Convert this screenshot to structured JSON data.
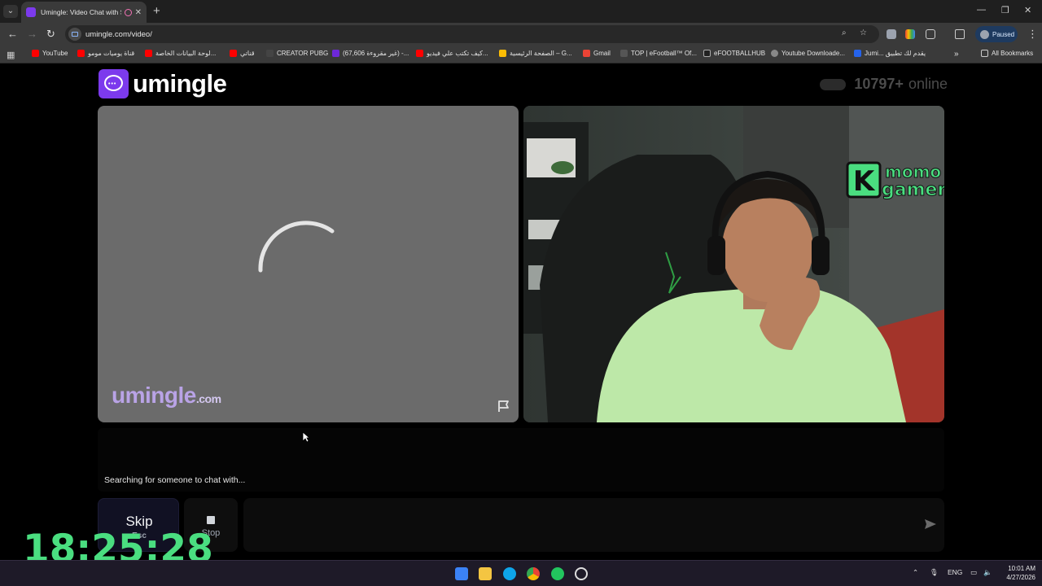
{
  "browser": {
    "tab_title": "Umingle: Video Chat with S",
    "url": "umingle.com/video/",
    "profile_status": "Paused",
    "all_bookmarks_label": "All Bookmarks",
    "bookmarks": [
      {
        "label": "YouTube",
        "color": "#ff0000"
      },
      {
        "label": "قناة يوميات مومو",
        "color": "#ff0000"
      },
      {
        "label": "لوحة البيانات الخاصة...",
        "color": "#ff0000"
      },
      {
        "label": "قناتي",
        "color": "#ff0000"
      },
      {
        "label": "CREATOR PUBG",
        "color": "#444444"
      },
      {
        "label": "(67,606 غير مقروءة) -...",
        "color": "#6d28d9"
      },
      {
        "label": "كيف تكتب علي فيديو...",
        "color": "#ff0000"
      },
      {
        "label": "الصفحة الرئيسية – G...",
        "color": "#fbbc04"
      },
      {
        "label": "Gmail",
        "color": "#ea4335"
      },
      {
        "label": "TOP | eFootball™ Of...",
        "color": "#555555"
      },
      {
        "label": "eFOOTBALLHUB",
        "color": "#222222"
      },
      {
        "label": "Youtube Downloade...",
        "color": "#888888"
      },
      {
        "label": "Jumi... يقدم لك تطبيق",
        "color": "#2563eb"
      }
    ]
  },
  "site": {
    "brand": "umingle",
    "online_count": "10797+",
    "online_label": "online",
    "watermark_main": "umingle",
    "watermark_suffix": ".com",
    "status_text": "Searching for someone to chat with...",
    "skip_label": "Skip",
    "skip_shortcut": "Esc",
    "stop_label": "Stop",
    "message_placeholder": ""
  },
  "overlay": {
    "stream_logo_top": "momo",
    "stream_logo_bottom": "gamer",
    "stream_logo_letter": "K",
    "timer": "18:25:28"
  },
  "taskbar": {
    "language": "ENG",
    "time": "10:01 AM",
    "date": "4/27/2026"
  },
  "colors": {
    "brand_purple": "#7c3aed",
    "timer_green": "#4ade80",
    "logo_green": "#4ade80"
  }
}
